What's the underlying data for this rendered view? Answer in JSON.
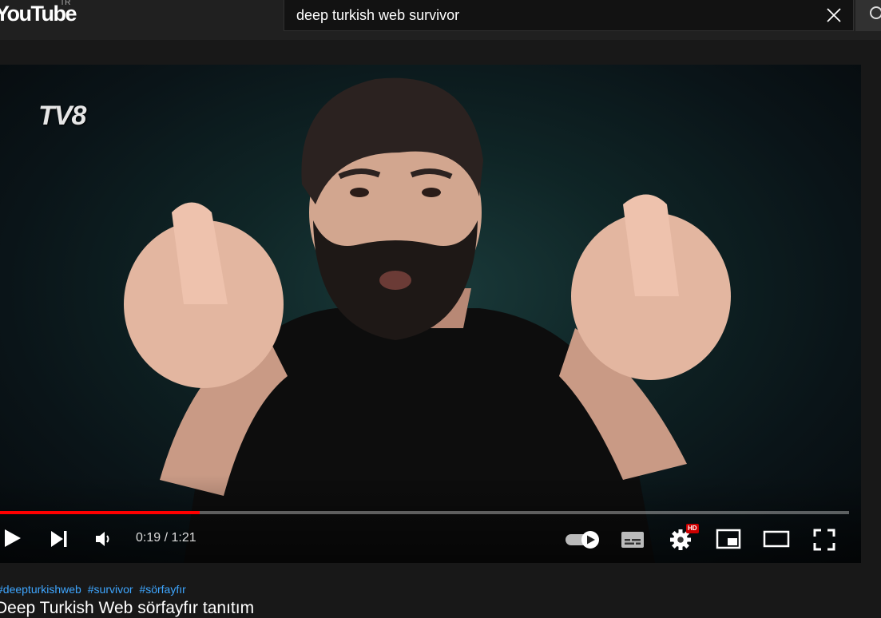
{
  "header": {
    "logo_text": "YouTube",
    "region": "TR",
    "search": {
      "value": "deep turkish web survivor",
      "clear_icon": "close-icon",
      "search_icon": "search-icon"
    }
  },
  "player": {
    "watermark": "TV8",
    "time_current": "0:19",
    "time_separator": "/",
    "time_total": "1:21",
    "progress_fraction": 0.235,
    "autoplay_on": true,
    "settings_badge": "HD",
    "colors": {
      "progress": "#ff0000",
      "hd_badge": "#cc0000"
    }
  },
  "video": {
    "hashtags": [
      "#deepturkishweb",
      "#survivor",
      "#sörfayfır"
    ],
    "title": "Deep Turkish Web sörfayfır tanıtım"
  }
}
